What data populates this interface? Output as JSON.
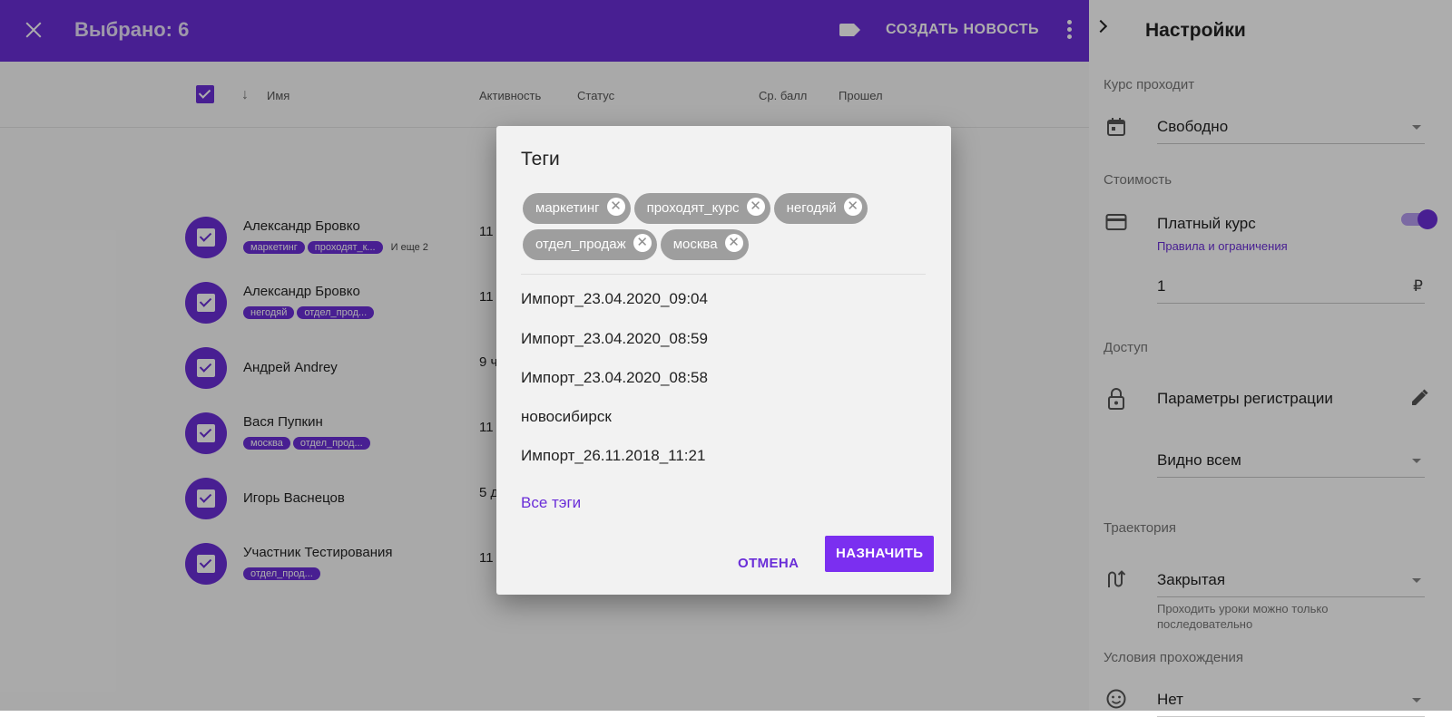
{
  "header": {
    "title": "Выбрано: 6",
    "create_news": "СОЗДАТЬ НОВОСТЬ"
  },
  "table": {
    "columns": [
      "Имя",
      "Активность",
      "Статус",
      "Ср. балл",
      "Прошел"
    ],
    "rows": [
      {
        "name": "Александр Бровко",
        "tags": [
          "маркетинг",
          "проходят_к..."
        ],
        "more": "И еще 2",
        "activity": "11"
      },
      {
        "name": "Александр Бровко",
        "tags": [
          "негодяй",
          "отдел_прод..."
        ],
        "more": "",
        "activity": "11"
      },
      {
        "name": "Андрей Andrey",
        "tags": [],
        "more": "",
        "activity": "9 ч"
      },
      {
        "name": "Вася Пупкин",
        "tags": [
          "москва",
          "отдел_прод..."
        ],
        "more": "",
        "activity": "11"
      },
      {
        "name": "Игорь Васнецов",
        "tags": [],
        "more": "",
        "activity": "5 д"
      },
      {
        "name": "Участник Тестирования",
        "tags": [
          "отдел_прод..."
        ],
        "more": "",
        "activity": "11"
      }
    ]
  },
  "dialog": {
    "title": "Теги",
    "chips": [
      "маркетинг",
      "проходят_курс",
      "негодяй",
      "отдел_продаж",
      "москва"
    ],
    "suggestions": [
      "Импорт_23.04.2020_09:04",
      "Импорт_23.04.2020_08:59",
      "Импорт_23.04.2020_08:58",
      "новосибирск",
      "Импорт_26.11.2018_11:21"
    ],
    "all_tags": "Все тэги",
    "cancel": "ОТМЕНА",
    "assign": "НАЗНАЧИТЬ"
  },
  "sidebar": {
    "title": "Настройки",
    "course_runs_label": "Курс проходит",
    "course_runs_value": "Свободно",
    "cost_label": "Стоимость",
    "paid_course": "Платный курс",
    "paid_toggle_on": true,
    "rules_link": "Правила и ограничения",
    "price_value": "1",
    "currency": "₽",
    "access_label": "Доступ",
    "registration_params": "Параметры регистрации",
    "visibility_value": "Видно всем",
    "trajectory_label": "Траектория",
    "trajectory_value": "Закрытая",
    "trajectory_hint": "Проходить уроки можно только последовательно",
    "conditions_label": "Условия прохождения",
    "conditions_value": "Нет"
  },
  "colors": {
    "accent": "#6a2ed8",
    "button": "#7b2ff0",
    "chip": "#9e9e9e"
  }
}
